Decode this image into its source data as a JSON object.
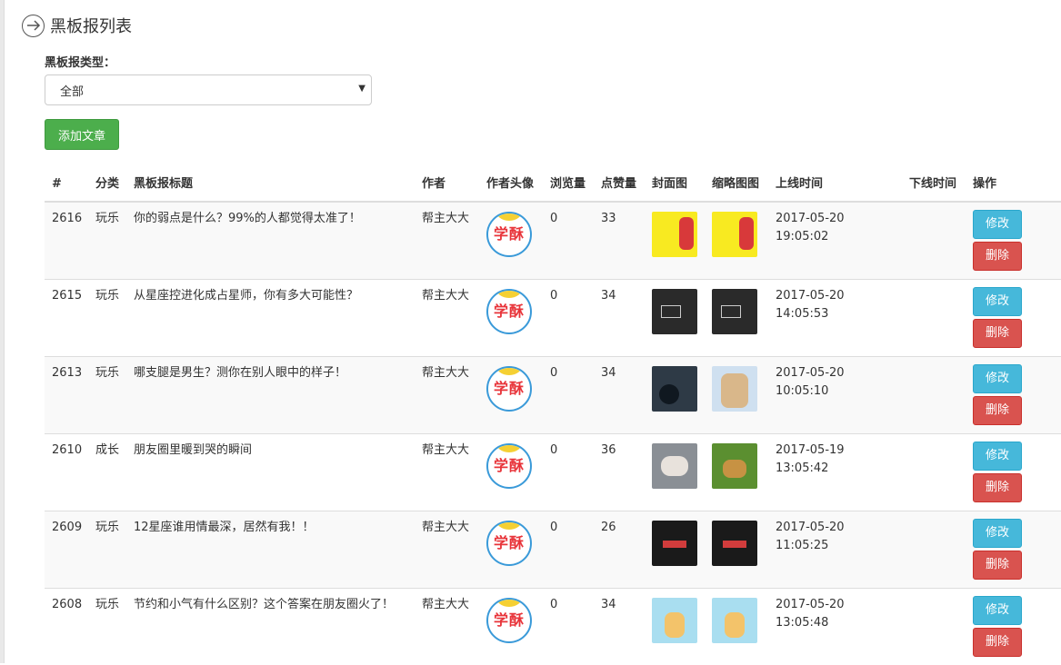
{
  "page": {
    "title": "黑板报列表"
  },
  "filter": {
    "label": "黑板报类型：",
    "selected": "全部"
  },
  "toolbar": {
    "add_label": "添加文章"
  },
  "table": {
    "headers": [
      "#",
      "分类",
      "黑板报标题",
      "作者",
      "作者头像",
      "浏览量",
      "点赞量",
      "封面图",
      "缩略图图",
      "上线时间",
      "下线时间",
      "操作"
    ],
    "edit_label": "修改",
    "delete_label": "删除",
    "rows": [
      {
        "id": "2616",
        "category": "玩乐",
        "title": "你的弱点是什么？99%的人都觉得太准了！",
        "author": "帮主大大",
        "avatar_text": "学酥",
        "views": "0",
        "likes": "33",
        "cover": "t-yellow",
        "thumb": "t-yellow",
        "online_date": "2017-05-20",
        "online_time": "19:05:02",
        "offline": ""
      },
      {
        "id": "2615",
        "category": "玩乐",
        "title": "从星座控进化成占星师，你有多大可能性？",
        "author": "帮主大大",
        "avatar_text": "学酥",
        "views": "0",
        "likes": "34",
        "cover": "t-night",
        "thumb": "t-night",
        "online_date": "2017-05-20",
        "online_time": "14:05:53",
        "offline": ""
      },
      {
        "id": "2613",
        "category": "玩乐",
        "title": "哪支腿是男生？测你在别人眼中的样子！",
        "author": "帮主大大",
        "avatar_text": "学酥",
        "views": "0",
        "likes": "34",
        "cover": "t-dark",
        "thumb": "t-anime",
        "online_date": "2017-05-20",
        "online_time": "10:05:10",
        "offline": ""
      },
      {
        "id": "2610",
        "category": "成长",
        "title": "朋友圈里暖到哭的瞬间",
        "author": "帮主大大",
        "avatar_text": "学酥",
        "views": "0",
        "likes": "36",
        "cover": "t-dog",
        "thumb": "t-green",
        "online_date": "2017-05-19",
        "online_time": "13:05:42",
        "offline": ""
      },
      {
        "id": "2609",
        "category": "玩乐",
        "title": "12星座谁用情最深，居然有我！！",
        "author": "帮主大大",
        "avatar_text": "学酥",
        "views": "0",
        "likes": "26",
        "cover": "t-black",
        "thumb": "t-black",
        "online_date": "2017-05-20",
        "online_time": "11:05:25",
        "offline": ""
      },
      {
        "id": "2608",
        "category": "玩乐",
        "title": "节约和小气有什么区别？这个答案在朋友圈火了！",
        "author": "帮主大大",
        "avatar_text": "学酥",
        "views": "0",
        "likes": "34",
        "cover": "t-blue",
        "thumb": "t-blue",
        "online_date": "2017-05-20",
        "online_time": "13:05:48",
        "offline": ""
      }
    ]
  }
}
